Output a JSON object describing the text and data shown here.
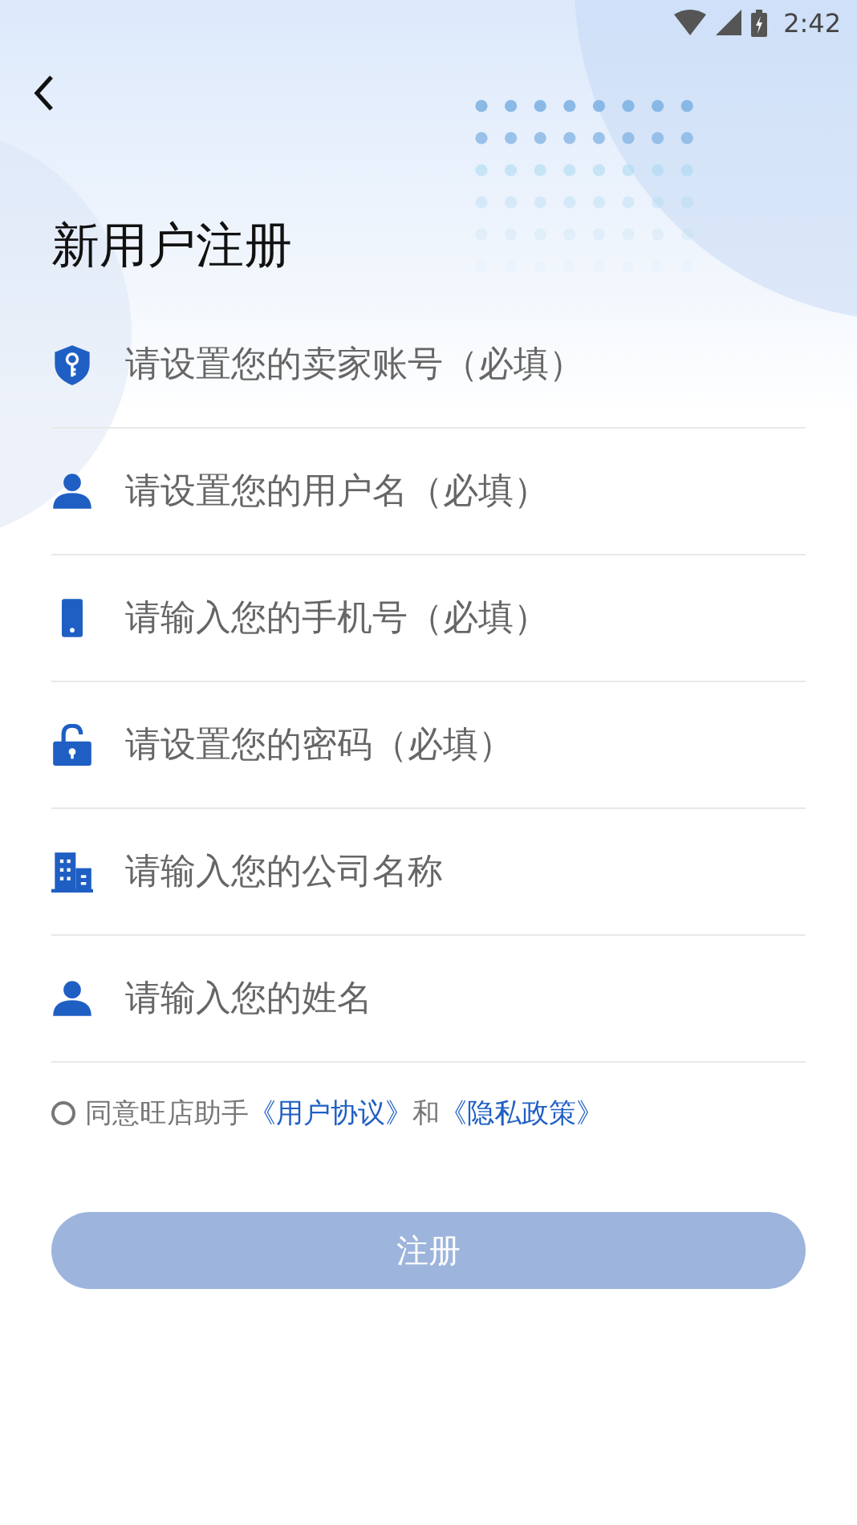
{
  "status_bar": {
    "time": "2:42"
  },
  "title": "新用户注册",
  "fields": [
    {
      "kind": "shield",
      "placeholder": "请设置您的卖家账号（必填）"
    },
    {
      "kind": "person",
      "placeholder": "请设置您的用户名（必填）"
    },
    {
      "kind": "phone",
      "placeholder": "请输入您的手机号（必填）"
    },
    {
      "kind": "lock",
      "placeholder": "请设置您的密码（必填）"
    },
    {
      "kind": "building",
      "placeholder": "请输入您的公司名称"
    },
    {
      "kind": "person",
      "placeholder": "请输入您的姓名"
    }
  ],
  "agreement": {
    "checked": false,
    "parts": [
      {
        "kind": "text",
        "text": "同意旺店助手"
      },
      {
        "kind": "link",
        "text": "《用户协议》"
      },
      {
        "kind": "text",
        "text": "和"
      },
      {
        "kind": "link",
        "text": "《隐私政策》"
      }
    ]
  },
  "submit": {
    "label": "注册",
    "disabled": true
  }
}
